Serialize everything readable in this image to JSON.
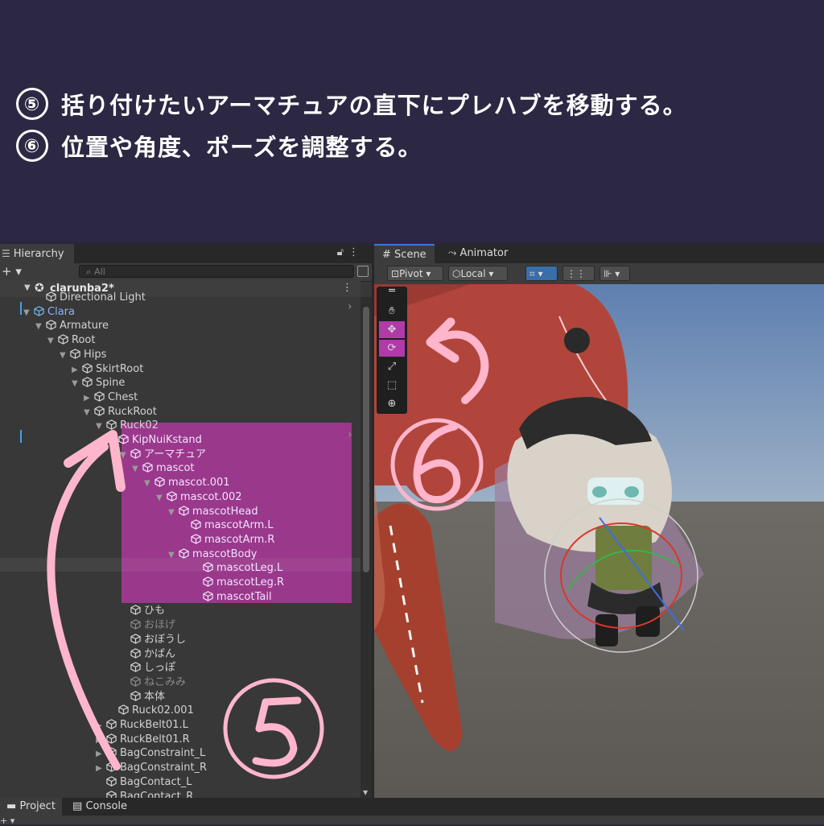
{
  "instructions": {
    "step5": {
      "marker": "⑤",
      "text": "括り付けたいアーマチュアの直下にプレハブを移動する。"
    },
    "step6": {
      "marker": "⑥",
      "text": "位置や角度、ポーズを調整する。"
    }
  },
  "hierarchy": {
    "tab_label": "Hierarchy",
    "add_label": "+ ▾",
    "search_placeholder": "All",
    "scene_name": "clarunba2*",
    "items": [
      {
        "label": "Directional Light",
        "indent": 5,
        "arrow": "",
        "style": ""
      },
      {
        "label": "Clara",
        "indent": 4,
        "arrow": "▼",
        "style": "pf"
      },
      {
        "label": "Armature",
        "indent": 5,
        "arrow": "▼",
        "style": ""
      },
      {
        "label": "Root",
        "indent": 6,
        "arrow": "▼",
        "style": ""
      },
      {
        "label": "Hips",
        "indent": 7,
        "arrow": "▼",
        "style": ""
      },
      {
        "label": "SkirtRoot",
        "indent": 8,
        "arrow": "▶",
        "style": ""
      },
      {
        "label": "Spine",
        "indent": 8,
        "arrow": "▼",
        "style": ""
      },
      {
        "label": "Chest",
        "indent": 9,
        "arrow": "▶",
        "style": ""
      },
      {
        "label": "RuckRoot",
        "indent": 9,
        "arrow": "▼",
        "style": ""
      },
      {
        "label": "Ruck02",
        "indent": 10,
        "arrow": "▼",
        "style": ""
      },
      {
        "label": "KipNuiKstand",
        "indent": 11,
        "arrow": "▼",
        "style": "pfh"
      },
      {
        "label": "アーマチュア",
        "indent": 12,
        "arrow": "▼",
        "style": "pfh"
      },
      {
        "label": "mascot",
        "indent": 13,
        "arrow": "▼",
        "style": "pfh"
      },
      {
        "label": "mascot.001",
        "indent": 14,
        "arrow": "▼",
        "style": "pfh"
      },
      {
        "label": "mascot.002",
        "indent": 15,
        "arrow": "▼",
        "style": "pfh"
      },
      {
        "label": "mascotHead",
        "indent": 16,
        "arrow": "▼",
        "style": "pfh"
      },
      {
        "label": "mascotArm.L",
        "indent": 17,
        "arrow": "",
        "style": "pfh"
      },
      {
        "label": "mascotArm.R",
        "indent": 17,
        "arrow": "",
        "style": "pfh"
      },
      {
        "label": "mascotBody",
        "indent": 16,
        "arrow": "▼",
        "style": "pfh"
      },
      {
        "label": "mascotLeg.L",
        "indent": 18,
        "arrow": "",
        "style": "pfh"
      },
      {
        "label": "mascotLeg.R",
        "indent": 18,
        "arrow": "",
        "style": "pfh"
      },
      {
        "label": "mascotTail",
        "indent": 18,
        "arrow": "",
        "style": "pfh"
      },
      {
        "label": "ひも",
        "indent": 12,
        "arrow": "",
        "style": ""
      },
      {
        "label": "おほげ",
        "indent": 12,
        "arrow": "",
        "style": "dim"
      },
      {
        "label": "おぼうし",
        "indent": 12,
        "arrow": "",
        "style": ""
      },
      {
        "label": "かばん",
        "indent": 12,
        "arrow": "",
        "style": ""
      },
      {
        "label": "しっぽ",
        "indent": 12,
        "arrow": "",
        "style": ""
      },
      {
        "label": "ねこみみ",
        "indent": 12,
        "arrow": "",
        "style": "dim"
      },
      {
        "label": "本体",
        "indent": 12,
        "arrow": "",
        "style": ""
      },
      {
        "label": "Ruck02.001",
        "indent": 11,
        "arrow": "",
        "style": ""
      },
      {
        "label": "RuckBelt01.L",
        "indent": 10,
        "arrow": "▶",
        "style": ""
      },
      {
        "label": "RuckBelt01.R",
        "indent": 10,
        "arrow": "▶",
        "style": ""
      },
      {
        "label": "BagConstraint_L",
        "indent": 10,
        "arrow": "▶",
        "style": ""
      },
      {
        "label": "BagConstraint_R",
        "indent": 10,
        "arrow": "▶",
        "style": ""
      },
      {
        "label": "BagContact_L",
        "indent": 10,
        "arrow": "",
        "style": ""
      },
      {
        "label": "BagContact_R",
        "indent": 10,
        "arrow": "",
        "style": ""
      }
    ]
  },
  "scene_view": {
    "tabs": [
      "Scene",
      "Animator"
    ],
    "pivot_label": "Pivot",
    "local_label": "Local"
  },
  "bottom": {
    "tabs": [
      "Project",
      "Console"
    ],
    "add_label": "+ ▾"
  },
  "colors": {
    "banner_bg": "#2c2843",
    "selection": "#b0389e",
    "annotation": "#ffb6cc",
    "prefab_blue": "#8ab4f8"
  }
}
